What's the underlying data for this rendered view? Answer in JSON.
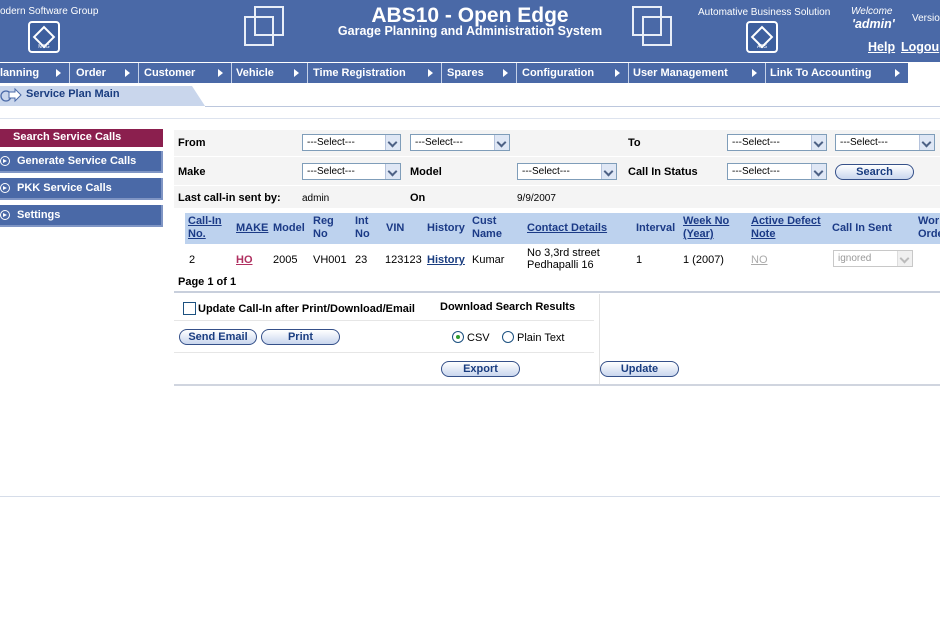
{
  "header": {
    "company": "odern Software Group",
    "left_logo_label": "MSG",
    "title": "ABS10 - Open Edge",
    "subtitle": "Garage Planning and Administration System",
    "abs_label": "Automative Business Solution",
    "right_logo_label": "ABS",
    "welcome": "Welcome",
    "user": "'admin'",
    "version": "Versio",
    "help": "Help",
    "logout": "Logou"
  },
  "menu": [
    {
      "label": "lanning"
    },
    {
      "label": "Order"
    },
    {
      "label": "Customer"
    },
    {
      "label": "Vehicle"
    },
    {
      "label": "Time Registration"
    },
    {
      "label": "Spares"
    },
    {
      "label": "Configuration"
    },
    {
      "label": "User Management"
    },
    {
      "label": "Link To Accounting"
    }
  ],
  "breadcrumb": "Service Plan Main",
  "sidebar": {
    "active": "Search Service Calls",
    "items": [
      {
        "label": "Generate Service Calls"
      },
      {
        "label": "PKK Service Calls"
      },
      {
        "label": "Settings"
      }
    ]
  },
  "search_form": {
    "from_label": "From",
    "to_label": "To",
    "make_label": "Make",
    "model_label": "Model",
    "status_label": "Call In Status",
    "select_placeholder": "---Select---",
    "search_button": "Search",
    "last_sent_label": "Last call-in sent by:",
    "last_sent_value": "admin",
    "on_label": "On",
    "on_value": "9/9/2007"
  },
  "table": {
    "columns": [
      {
        "line1": "Call-In",
        "line2": "No."
      },
      {
        "line1": "MAKE",
        "line2": ""
      },
      {
        "line1": "Model",
        "line2": ""
      },
      {
        "line1": "Reg",
        "line2": "No"
      },
      {
        "line1": "Int",
        "line2": "No"
      },
      {
        "line1": "VIN",
        "line2": ""
      },
      {
        "line1": "History",
        "line2": ""
      },
      {
        "line1": "Cust",
        "line2": "Name"
      },
      {
        "line1": "Contact Details",
        "line2": ""
      },
      {
        "line1": "Interval",
        "line2": ""
      },
      {
        "line1": "Week No",
        "line2": "(Year)"
      },
      {
        "line1": "Active Defect",
        "line2": "Note"
      },
      {
        "line1": "Call In Sent",
        "line2": ""
      },
      {
        "line1": "Wor",
        "line2": "Orde"
      }
    ],
    "rows": [
      {
        "call_in_no": "2",
        "make": "HO",
        "model": "2005",
        "reg_no": "VH001",
        "int_no": "23",
        "vin": "123123",
        "history": "History",
        "cust_name": "Kumar",
        "contact_line1": "No 3,3rd street",
        "contact_line2": "Pedhapalli 16",
        "interval": "1",
        "week_no": "1 (2007)",
        "defect_note": "NO",
        "call_in_sent": "ignored"
      }
    ],
    "page_info": "Page 1 of 1"
  },
  "actions": {
    "update_checkbox_label": "Update Call-In after Print/Download/Email",
    "download_label": "Download Search Results",
    "send_email": "Send Email",
    "print": "Print",
    "csv_label": "CSV",
    "plain_text_label": "Plain Text",
    "export": "Export",
    "update": "Update"
  },
  "colors": {
    "header_blue": "#4a69a7",
    "active_item": "#8b1f4e",
    "table_header": "#bdd2ee"
  }
}
